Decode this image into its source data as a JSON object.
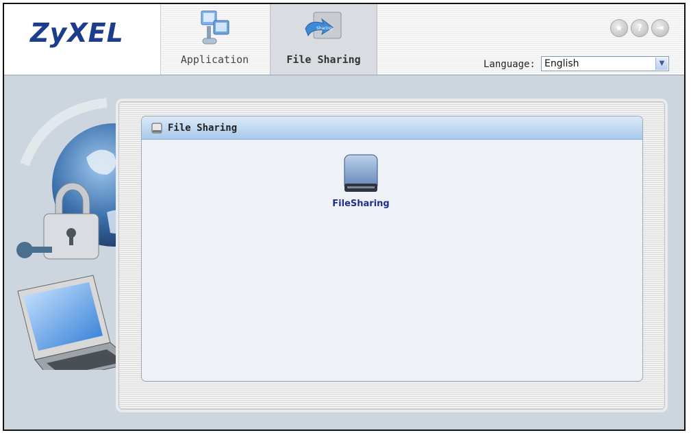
{
  "header": {
    "logo": "ZyXEL",
    "tabs": [
      {
        "label": "Application",
        "active": false
      },
      {
        "label": "File Sharing",
        "active": true
      }
    ],
    "top_icons": [
      "home-icon",
      "help-icon",
      "logout-icon"
    ],
    "language": {
      "label": "Language:",
      "selected": "English"
    }
  },
  "main": {
    "panel_title": "File Sharing",
    "items": [
      {
        "label": "FileSharing",
        "icon": "hard-drive-icon"
      }
    ]
  },
  "colors": {
    "brand": "#1c3c8c",
    "link": "#1e2f8c",
    "content_bg": "#cdd6de",
    "title_bar": "#a9c9ea"
  }
}
